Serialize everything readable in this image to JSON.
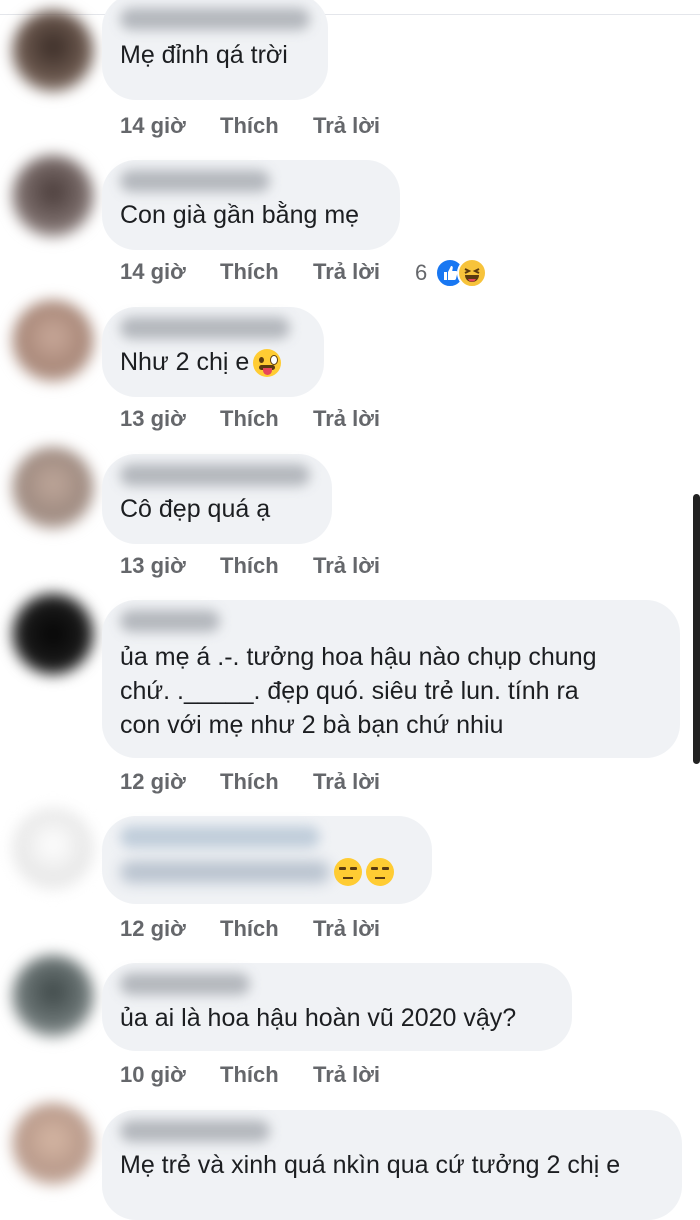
{
  "comments": [
    {
      "text": "Mẹ đỉnh qá trời",
      "time": "14 giờ",
      "like": "Thích",
      "reply": "Trả lời"
    },
    {
      "text": "Con già gần bằng mẹ",
      "time": "14 giờ",
      "like": "Thích",
      "reply": "Trả lời",
      "reaction_count": "6"
    },
    {
      "text": "Như 2 chị e",
      "time": "13 giờ",
      "like": "Thích",
      "reply": "Trả lời"
    },
    {
      "text": "Cô đẹp quá ạ",
      "time": "13 giờ",
      "like": "Thích",
      "reply": "Trả lời"
    },
    {
      "text": "ủa mẹ á .-. tưởng hoa hậu nào chụp chung\nchứ. ._____. đẹp quó. siêu trẻ lun. tính ra\ncon với mẹ như 2 bà bạn chứ nhiu",
      "time": "12 giờ",
      "like": "Thích",
      "reply": "Trả lời"
    },
    {
      "text": "",
      "time": "12 giờ",
      "like": "Thích",
      "reply": "Trả lời"
    },
    {
      "text": "ủa ai là hoa hậu hoàn vũ 2020 vậy?",
      "time": "10 giờ",
      "like": "Thích",
      "reply": "Trả lời"
    },
    {
      "text": "Mẹ trẻ và xinh quá nkìn qua cứ tưởng 2 chị e"
    }
  ],
  "colors": {
    "bubble": "#f0f2f5",
    "meta_text": "#65676b",
    "body_text": "#1c1e21",
    "like_blue": "#1877f2",
    "emoji_yellow": "#ffcc33"
  },
  "icons": {
    "reaction_like": "thumbs-up-icon",
    "reaction_haha": "laughing-face-icon",
    "emoji_tongue": "tongue-out-emoji",
    "emoji_unamused": "unamused-emoji"
  }
}
